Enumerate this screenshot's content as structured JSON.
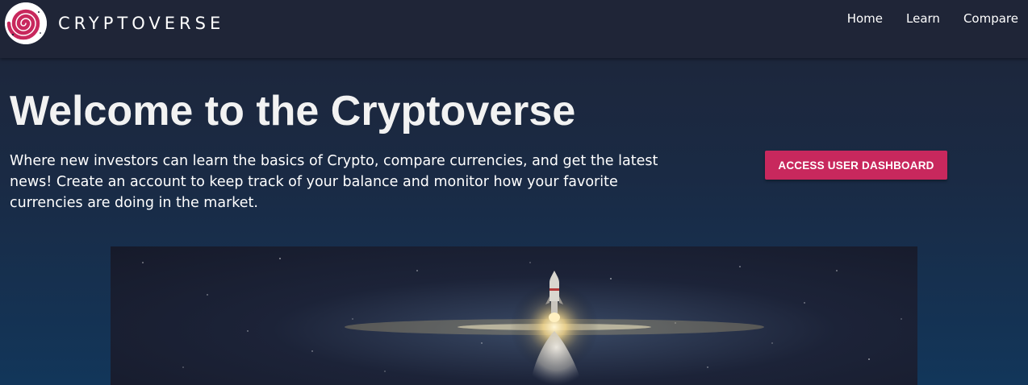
{
  "brand": {
    "name": "CRYPTOVERSE",
    "logo_icon": "galaxy-spiral-icon",
    "logo_color": "#c8285d"
  },
  "nav": {
    "items": [
      {
        "label": "Home"
      },
      {
        "label": "Learn"
      },
      {
        "label": "Compare"
      }
    ]
  },
  "hero": {
    "title": "Welcome to the Cryptoverse",
    "description": "Where new investors can learn the basics of Crypto, compare currencies, and get the latest news! Create an account to keep track of your balance and monitor how your favorite currencies are doing in the market.",
    "cta_label": "ACCESS USER DASHBOARD",
    "cta_color": "#c8285d",
    "image": "rocket-launch-in-space"
  }
}
